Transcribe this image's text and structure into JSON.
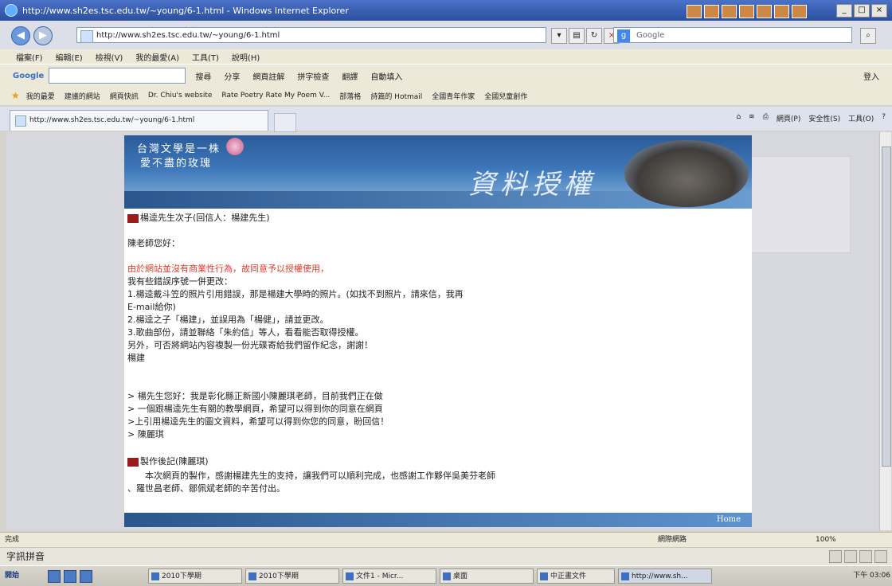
{
  "window": {
    "title": "http://www.sh2es.tsc.edu.tw/~young/6-1.html - Windows Internet Explorer"
  },
  "address": {
    "url": "http://www.sh2es.tsc.edu.tw/~young/6-1.html",
    "search_placeholder": "Google"
  },
  "menu": [
    "檔案(F)",
    "編輯(E)",
    "檢視(V)",
    "我的最愛(A)",
    "工具(T)",
    "說明(H)"
  ],
  "google_bar": {
    "logo": "Google",
    "buttons": [
      "搜尋",
      "分享",
      "網頁註解",
      "拼字檢查",
      "翻譯",
      "自動填入",
      "登入"
    ]
  },
  "favorites": {
    "label": "我的最愛",
    "items": [
      "建議的網站",
      "網頁快訊",
      "Dr. Chiu's website",
      "Rate Poetry Rate My Poem V...",
      "部落格",
      "詩篇的 Hotmail",
      "全國青年作家",
      "全國兒童創作"
    ]
  },
  "tab": {
    "label": "http://www.sh2es.tsc.edu.tw/~young/6-1.html"
  },
  "commands": [
    "網頁(P)",
    "安全性(S)",
    "工具(O)"
  ],
  "banner": {
    "line1": "台灣文學是一株",
    "line2": "愛不盡的玫瑰",
    "title": "資料授權"
  },
  "letter": {
    "heading1": "楊逵先生次子(回信人：楊建先生)",
    "greeting": "陳老師您好：",
    "notice": "由於網站並沒有商業性行為，故同意予以授權使用，",
    "line1": "我有些錯誤序號一併更改：",
    "item1a": "1.楊逵戴斗笠的照片引用錯誤，那是楊建大學時的照片。(如找不到照片，請來信，我再",
    "item1b": "E-mail給你)",
    "item2": "2.楊逵之子「楊建」，並誤用為「楊健」，請並更改。",
    "item3": "3.歌曲部份，請並聯絡「朱約信」等人，看看能否取得授權。",
    "other": "另外，可否將網站內容複製一份光碟寄給我們留作紀念，謝謝！",
    "sign": "楊建",
    "quote1": "> 楊先生您好：我是彰化縣正新國小陳麗琪老師，目前我們正在做",
    "quote2": "> 一個跟楊逵先生有關的教學網頁，希望可以得到你的同意在網頁",
    "quote3": ">上引用楊逵先生的圖文資料，希望可以得到你您的同意，盼回信！",
    "quote4": "> 陳麗琪",
    "heading2": "製作後記(陳麗琪)",
    "after1": "本次網頁的製作，感謝楊建先生的支持，讓我們可以順利完成，也感謝工作夥伴吳美芬老師",
    "after2": "、羅世昌老師、鄒佩斌老師的辛苦付出。",
    "home": "Home"
  },
  "status": {
    "text": "完成",
    "zone": "網際網路",
    "zoom": "100%"
  },
  "ime": {
    "label": "字訊拼音"
  },
  "taskbar": {
    "start": "開始",
    "buttons": [
      "2010下學期",
      "2010下學期",
      "文件1 - Micr...",
      "桌面",
      "中正畫文件",
      "http://www.sh..."
    ],
    "clock": "下午 03:06"
  }
}
